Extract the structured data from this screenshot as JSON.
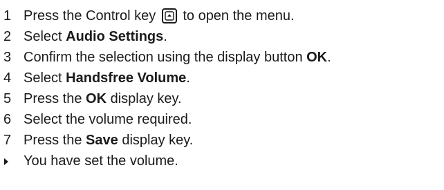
{
  "steps": [
    {
      "num": "1",
      "pre": "Press the Control key",
      "post": " to open the menu."
    },
    {
      "num": "2",
      "pre": "Select ",
      "bold": "Audio Settings",
      "post": "."
    },
    {
      "num": "3",
      "pre": "Confirm the selection using the display button ",
      "bold": "OK",
      "post": "."
    },
    {
      "num": "4",
      "pre": "Select ",
      "bold": "Handsfree Volume",
      "post": "."
    },
    {
      "num": "5",
      "pre": "Press the ",
      "bold": "OK",
      "post": " display key."
    },
    {
      "num": "6",
      "pre": "Select the volume required."
    },
    {
      "num": "7",
      "pre": "Press the ",
      "bold": "Save",
      "post": " display key."
    }
  ],
  "result": "You have set the volume."
}
